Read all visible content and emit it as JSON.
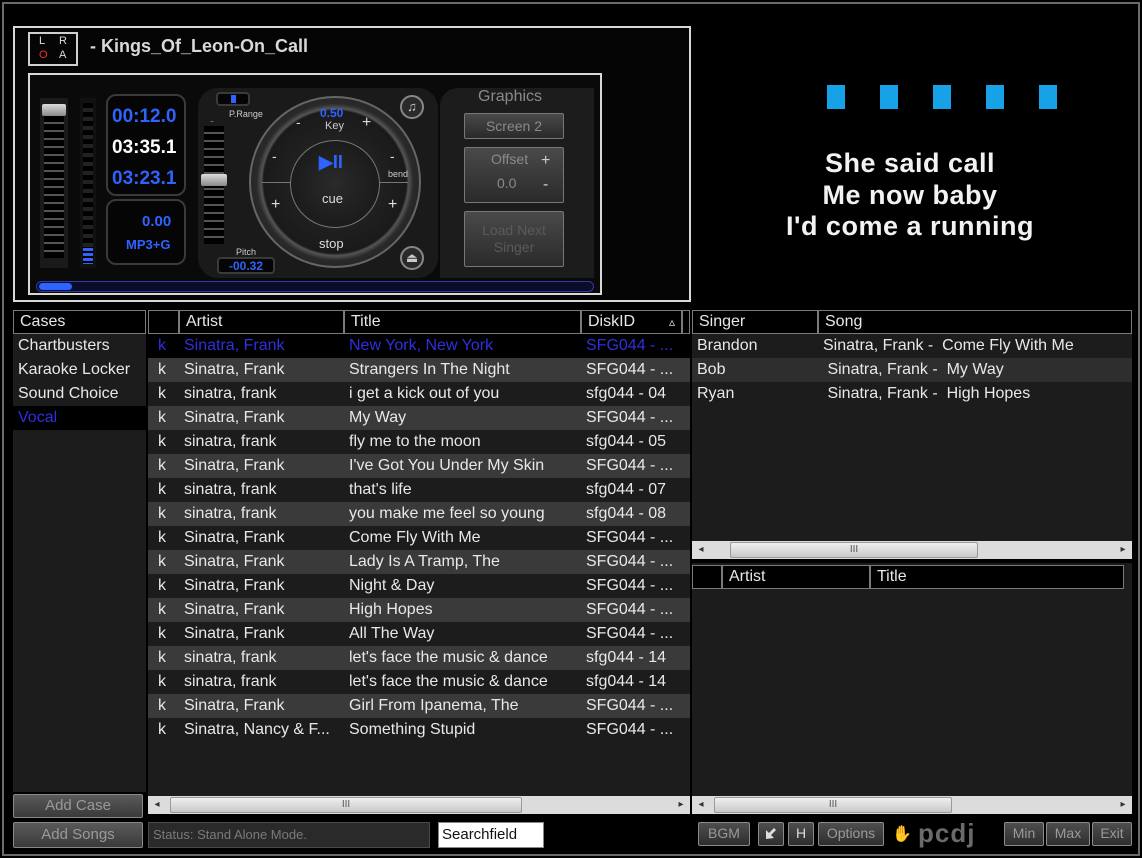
{
  "window": {
    "title": "- Kings_Of_Leon-On_Call"
  },
  "lra": {
    "l": "L",
    "r": "R",
    "o": "O",
    "a": "A"
  },
  "player": {
    "time_elapsed": "00:12.0",
    "time_total": "03:35.1",
    "time_remaining": "03:23.1",
    "level": "0.00",
    "format": "MP3+G",
    "p_range_label": "P.Range",
    "pitch_label": "Pitch",
    "pitch_value": "-00.32",
    "key_value": "0.50",
    "key_label": "Key",
    "bend_label": "bend",
    "cue_label": "cue",
    "stop_label": "stop",
    "minus": "-",
    "plus": "+",
    "play_pause": "▶II",
    "eject": "⏏",
    "music_note": "♫",
    "progress": 0.06
  },
  "graphics": {
    "title": "Graphics",
    "screen_button": "Screen 2",
    "offset_label": "Offset",
    "offset_value": "0.0",
    "plus": "+",
    "minus": "-",
    "load_next_line1": "Load Next",
    "load_next_line2": "Singer"
  },
  "display": {
    "lyrics": [
      "She said call",
      "Me now baby",
      "I'd come a running"
    ],
    "beat_color": "#17a2e8",
    "beats": 5
  },
  "cases": {
    "header": "Cases",
    "items": [
      "Chartbusters",
      "Karaoke Locker",
      "Sound Choice",
      "Vocal"
    ],
    "selected_index": 3
  },
  "songs": {
    "headers": {
      "flag": "",
      "artist": "Artist",
      "title": "Title",
      "disk": "DiskID",
      "sort": "▵"
    },
    "rows": [
      {
        "k": "k",
        "artist": "Sinatra, Frank",
        "title": "New York, New York",
        "disk": "SFG044 - ..."
      },
      {
        "k": "k",
        "artist": "Sinatra, Frank",
        "title": "Strangers In The Night",
        "disk": "SFG044 - ..."
      },
      {
        "k": "k",
        "artist": "sinatra, frank",
        "title": "i get a kick out of you",
        "disk": "sfg044 - 04"
      },
      {
        "k": "k",
        "artist": "Sinatra, Frank",
        "title": "My Way",
        "disk": "SFG044 - ..."
      },
      {
        "k": "k",
        "artist": "sinatra, frank",
        "title": "fly me to the moon",
        "disk": "sfg044 - 05"
      },
      {
        "k": "k",
        "artist": "Sinatra, Frank",
        "title": "I've Got You Under My Skin",
        "disk": "SFG044 - ..."
      },
      {
        "k": "k",
        "artist": "sinatra, frank",
        "title": "that's life",
        "disk": "sfg044 - 07"
      },
      {
        "k": "k",
        "artist": "sinatra, frank",
        "title": "you make me feel so young",
        "disk": "sfg044 - 08"
      },
      {
        "k": "k",
        "artist": "Sinatra, Frank",
        "title": "Come Fly With Me",
        "disk": "SFG044 - ..."
      },
      {
        "k": "k",
        "artist": "Sinatra, Frank",
        "title": "Lady Is A Tramp, The",
        "disk": "SFG044 - ..."
      },
      {
        "k": "k",
        "artist": "Sinatra, Frank",
        "title": "Night & Day",
        "disk": "SFG044 - ..."
      },
      {
        "k": "k",
        "artist": "Sinatra, Frank",
        "title": "High Hopes",
        "disk": "SFG044 - ..."
      },
      {
        "k": "k",
        "artist": "Sinatra, Frank",
        "title": "All The Way",
        "disk": "SFG044 - ..."
      },
      {
        "k": "k",
        "artist": "sinatra, frank",
        "title": "let's face the music & dance",
        "disk": "sfg044 - 14"
      },
      {
        "k": "k",
        "artist": "sinatra, frank",
        "title": "let's face the music & dance",
        "disk": "sfg044 - 14"
      },
      {
        "k": "k",
        "artist": "Sinatra, Frank",
        "title": "Girl From Ipanema, The",
        "disk": "SFG044 - ..."
      },
      {
        "k": "k",
        "artist": "Sinatra, Nancy & F...",
        "title": "Something Stupid",
        "disk": "SFG044 - ..."
      }
    ],
    "selected_index": 0
  },
  "singers": {
    "headers": {
      "singer": "Singer",
      "song": "Song"
    },
    "rows": [
      {
        "singer": "Brandon",
        "song": "Sinatra, Frank -  Come Fly With Me"
      },
      {
        "singer": "Bob",
        "song": " Sinatra, Frank -  My Way"
      },
      {
        "singer": "Ryan",
        "song": " Sinatra, Frank -  High Hopes"
      }
    ]
  },
  "history": {
    "headers": {
      "artist": "Artist",
      "title": "Title"
    }
  },
  "bottom": {
    "add_case": "Add Case",
    "add_songs": "Add Songs",
    "status": "Status: Stand Alone Mode.",
    "search": "Searchfield",
    "bgm": "BGM",
    "h": "H",
    "options": "Options",
    "logo": "pcdj",
    "min": "Min",
    "max": "Max",
    "exit": "Exit"
  },
  "scroll": {
    "grip": "III",
    "left": "◂",
    "right": "▸"
  }
}
